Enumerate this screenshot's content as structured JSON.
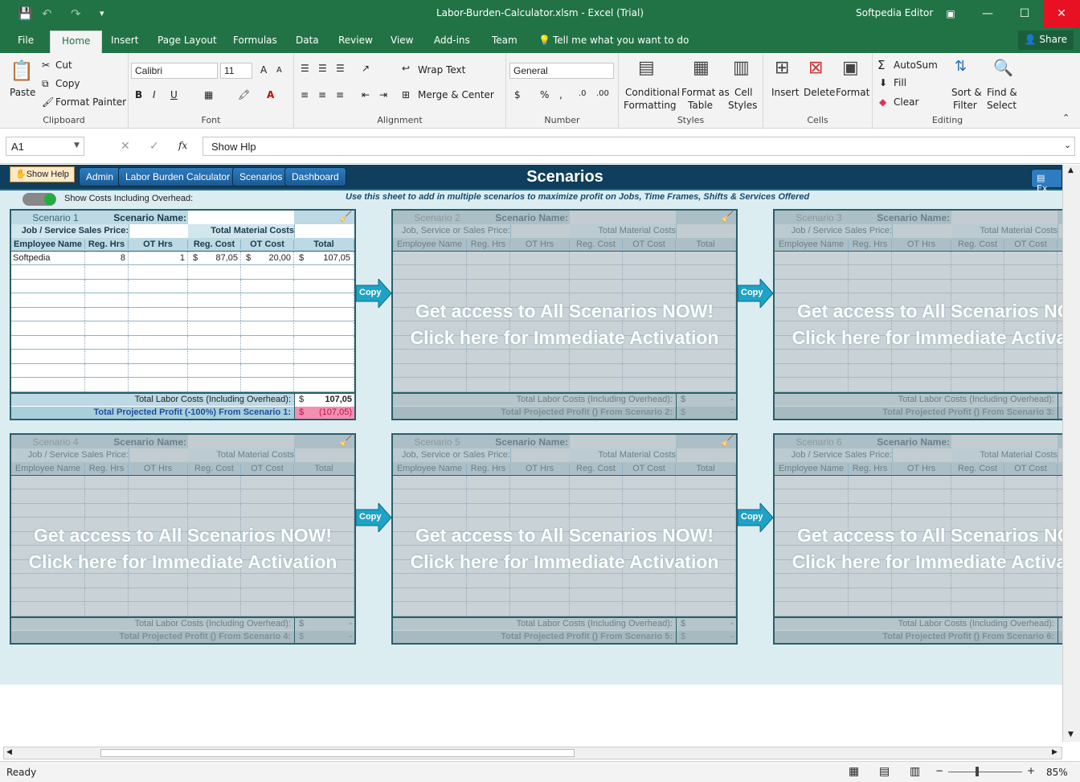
{
  "window": {
    "title": "Labor-Burden-Calculator.xlsm - Excel (Trial)",
    "user": "Softpedia Editor",
    "min": "—",
    "max": "☐",
    "close": "✕"
  },
  "tabs": [
    "File",
    "Home",
    "Insert",
    "Page Layout",
    "Formulas",
    "Data",
    "Review",
    "View",
    "Add-ins",
    "Team"
  ],
  "tell_me": "Tell me what you want to do",
  "share": "Share",
  "ribbon": {
    "clipboard": {
      "paste": "Paste",
      "cut": "Cut",
      "copy": "Copy",
      "format_painter": "Format Painter",
      "label": "Clipboard"
    },
    "font": {
      "name": "Calibri",
      "size": "11",
      "bold": "B",
      "italic": "I",
      "underline": "U",
      "label": "Font"
    },
    "alignment": {
      "wrap": "Wrap Text",
      "merge": "Merge & Center",
      "label": "Alignment"
    },
    "number": {
      "format": "General",
      "currency": "$",
      "percent": "%",
      "comma": ",",
      "label": "Number"
    },
    "styles": {
      "conditional": [
        "Conditional",
        "Formatting"
      ],
      "format_table": [
        "Format as",
        "Table"
      ],
      "cell_styles": [
        "Cell",
        "Styles"
      ],
      "label": "Styles"
    },
    "cells": {
      "insert": "Insert",
      "delete": "Delete",
      "format": "Format",
      "label": "Cells"
    },
    "editing": {
      "autosum": "AutoSum",
      "fill": "Fill",
      "clear": "Clear",
      "sort": [
        "Sort &",
        "Filter"
      ],
      "find": [
        "Find &",
        "Select"
      ],
      "label": "Editing"
    }
  },
  "formula_bar": {
    "name_box": "A1",
    "cancel": "✕",
    "enter": "✓",
    "fx": "fx",
    "content": "Show Hlp"
  },
  "sheet": {
    "show_help": "Show Help",
    "nav": [
      "Admin",
      "Labor Burden Calculator",
      "Scenarios",
      "Dashboard"
    ],
    "title": "Scenarios",
    "export": "Ex",
    "toggle_label": "Show Costs Including Overhead:",
    "hint": "Use this sheet to add in multiple scenarios to maximize profit on Jobs, Time Frames, Shifts & Services Offered",
    "copy_label": "Copy",
    "lock_msg": [
      "Get access to All Scenarios NOW!",
      "Click here for Immediate Activation"
    ],
    "headers": {
      "scenario_name": "Scenario Name:",
      "total_material": "Total Material Costs",
      "cols": [
        "Employee Name",
        "Reg. Hrs",
        "OT Hrs",
        "Reg. Cost",
        "OT Cost",
        "Total"
      ],
      "total_labor": "Total Labor Costs (Including Overhead):"
    },
    "scenarios": [
      {
        "label": "Scenario 1",
        "price_label": "Job / Service Sales Price:",
        "profit_label": "Total Projected Profit (-100%) From Scenario 1:",
        "labor_total": "107,05",
        "profit": "(107,05)",
        "rows": [
          {
            "name": "Softpedia",
            "reg_hrs": "8",
            "ot_hrs": "1",
            "reg_cost": "87,05",
            "ot_cost": "20,00",
            "total": "107,05"
          }
        ]
      },
      {
        "label": "Scenario 2",
        "price_label": "Job, Service or Sales Price:",
        "profit_label": "Total Projected Profit () From Scenario 2:",
        "labor_total": "-",
        "profit": "-"
      },
      {
        "label": "Scenario 3",
        "price_label": "Job / Service Sales Price:",
        "profit_label": "Total Projected Profit () From Scenario 3:",
        "labor_total": "-",
        "profit": "-"
      },
      {
        "label": "Scenario 4",
        "price_label": "Job / Service Sales Price:",
        "profit_label": "Total Projected Profit () From Scenario 4:",
        "labor_total": "-",
        "profit": "-"
      },
      {
        "label": "Scenario 5",
        "price_label": "Job, Service or Sales Price:",
        "profit_label": "Total Projected Profit () From Scenario 5:",
        "labor_total": "-",
        "profit": "-"
      },
      {
        "label": "Scenario 6",
        "price_label": "Job / Service Sales Price:",
        "profit_label": "Total Projected Profit () From Scenario 6:",
        "labor_total": "-",
        "profit": "-"
      }
    ]
  },
  "status": {
    "ready": "Ready",
    "zoom": "85%",
    "minus": "−",
    "plus": "+"
  },
  "colors": {
    "excel_green": "#217346",
    "nav_dark": "#0f3f5c",
    "profit_negative": "#f48fb1"
  }
}
